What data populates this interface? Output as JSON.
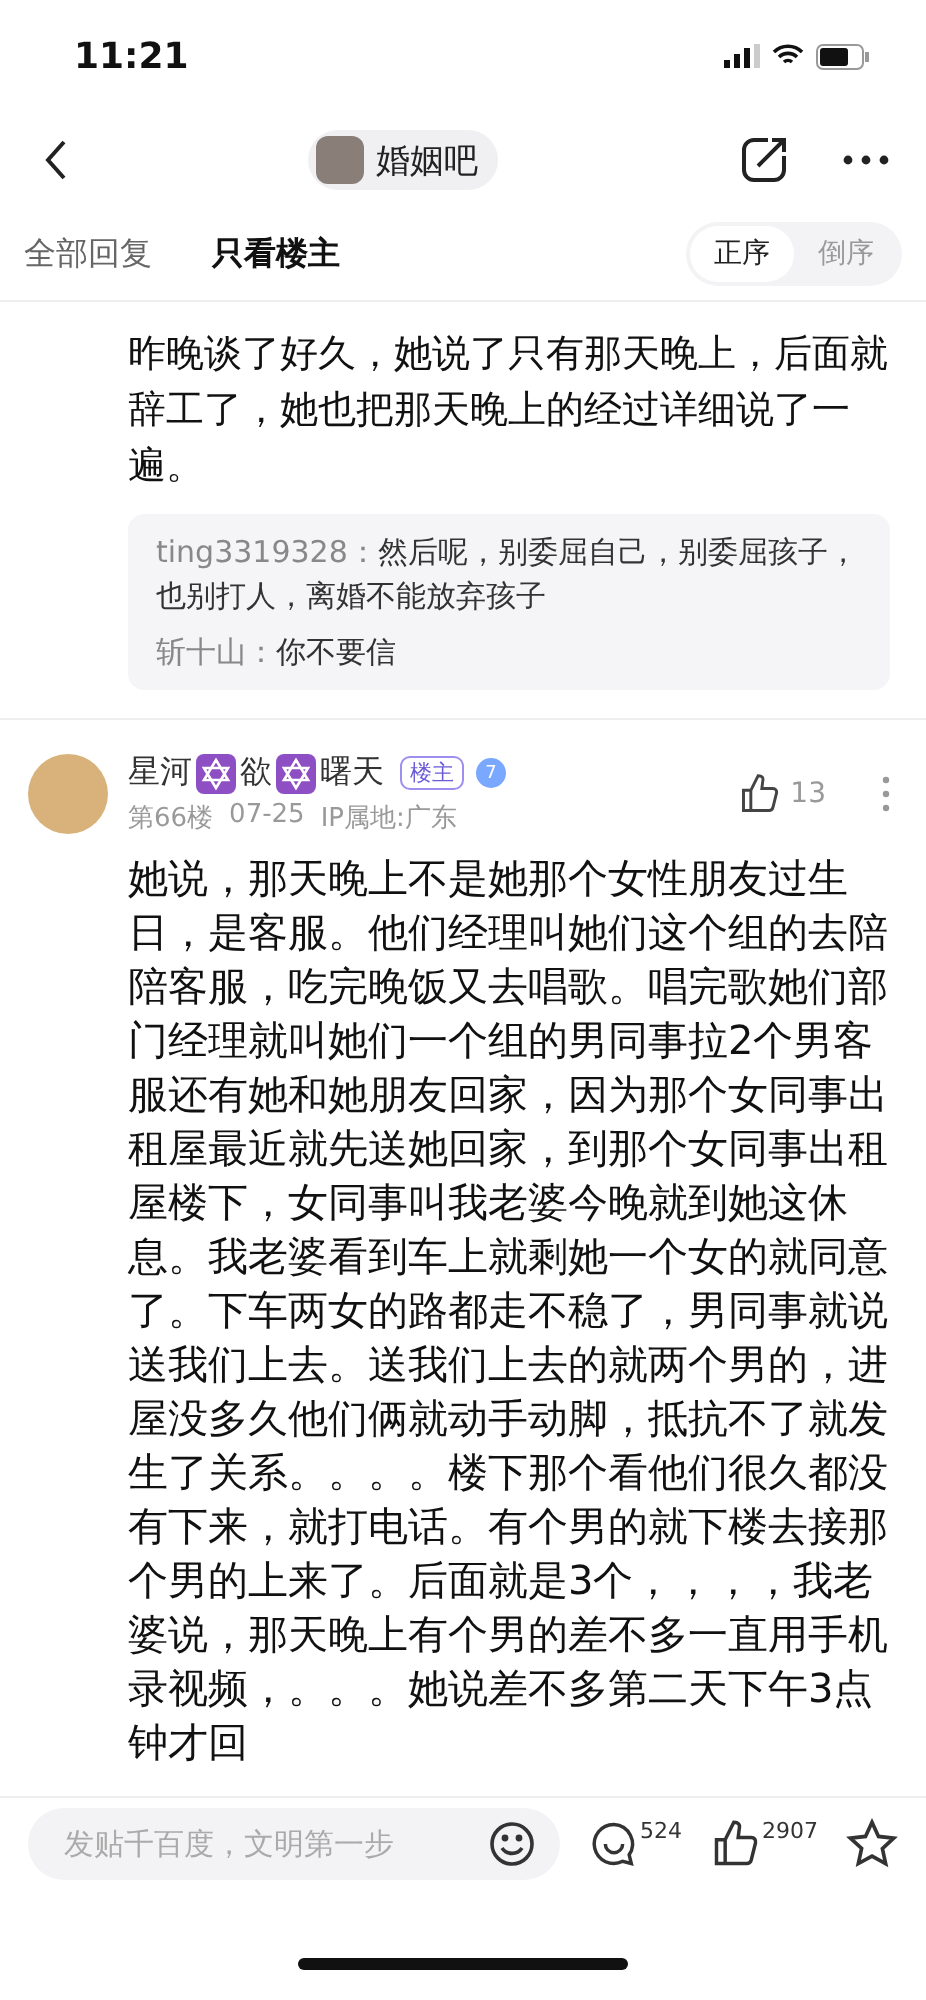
{
  "status_bar": {
    "time": "11:21"
  },
  "nav": {
    "forum": "婚姻吧"
  },
  "tabs": [
    {
      "label": "全部回复",
      "selected": false
    },
    {
      "label": "只看楼主",
      "selected": true
    }
  ],
  "sort": [
    {
      "label": "正序",
      "selected": true
    },
    {
      "label": "倒序",
      "selected": false
    }
  ],
  "prev_post": {
    "text": "昨晚谈了好久，她说了只有那天晚上，后面就辞工了，她也把那天晚上的经过详细说了一遍。",
    "replies": [
      {
        "user": "ting3319328：",
        "text": "然后呢，别委屈自己，别委屈孩子，也别打人，离婚不能放弃孩子"
      },
      {
        "user": "斩十山：",
        "text": "你不要信"
      }
    ]
  },
  "post": {
    "name": [
      {
        "kind": "text",
        "text": "星河"
      },
      {
        "kind": "star"
      },
      {
        "kind": "text",
        "text": "欲"
      },
      {
        "kind": "star"
      },
      {
        "kind": "text",
        "text": "曙天"
      }
    ],
    "owner_tag": "楼主",
    "level": "7",
    "floor": "第66楼",
    "date": "07-25",
    "ip": "IP属地:广东",
    "likes": "13",
    "body": "她说，那天晚上不是她那个女性朋友过生日，是客服。他们经理叫她们这个组的去陪陪客服，吃完晚饭又去唱歌。唱完歌她们部门经理就叫她们一个组的男同事拉2个男客服还有她和她朋友回家，因为那个女同事出租屋最近就先送她回家，到那个女同事出租屋楼下，女同事叫我老婆今晚就到她这休息。我老婆看到车上就剩她一个女的就同意了。下车两女的路都走不稳了，男同事就说送我们上去。送我们上去的就两个男的，进屋没多久他们俩就动手动脚，抵抗不了就发生了关系。。。。楼下那个看他们很久都没有下来，就打电话。有个男的就下楼去接那个男的上来了。后面就是3个，，，，我老婆说，那天晚上有个男的差不多一直用手机录视频，。。。她说差不多第二天下午3点钟才回"
  },
  "bottom_bar": {
    "placeholder": "发贴千百度，文明第一步",
    "comments": "524",
    "likes": "2907"
  }
}
